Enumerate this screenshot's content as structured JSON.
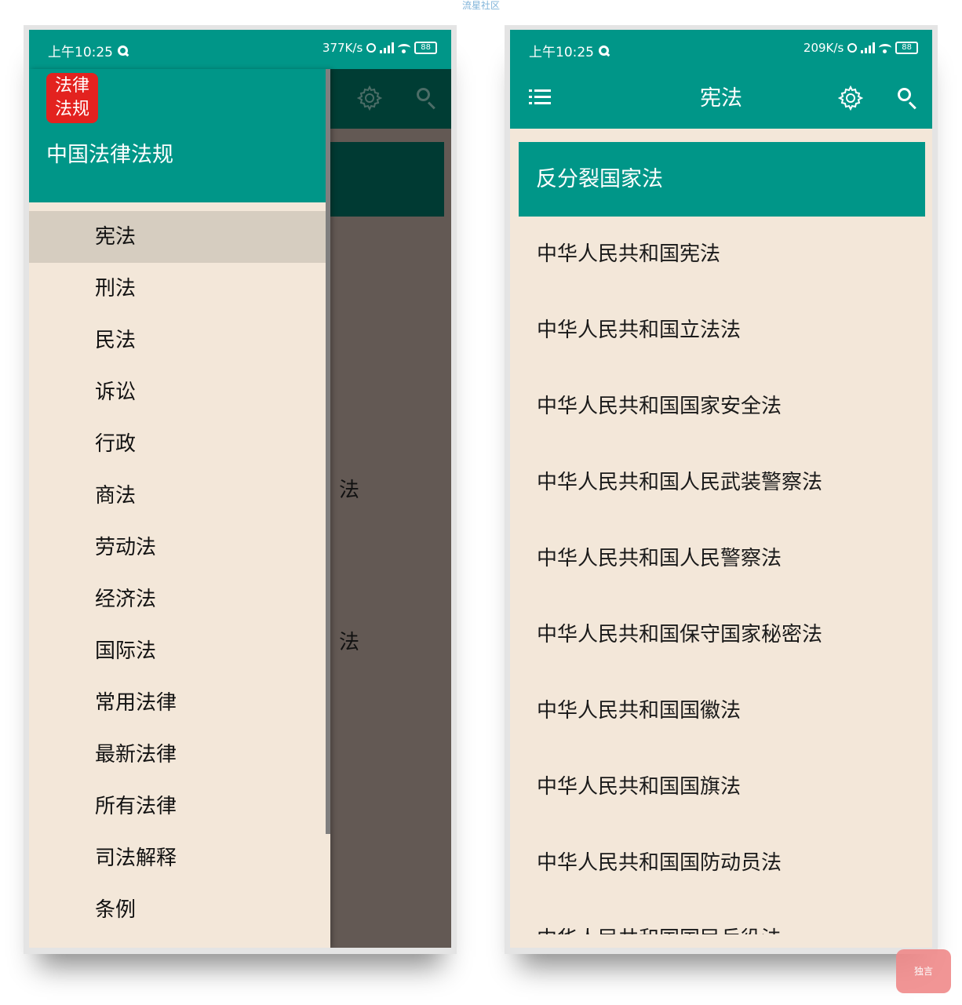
{
  "watermark": "流星社区",
  "left_phone": {
    "status": {
      "time": "上午10:25",
      "speed": "377K/s",
      "battery": "88"
    },
    "bg_fragments": [
      "法",
      "法"
    ],
    "drawer": {
      "logo_line1": "法律",
      "logo_line2": "法规",
      "title": "中国法律法规",
      "items": [
        "宪法",
        "刑法",
        "民法",
        "诉讼",
        "行政",
        "商法",
        "劳动法",
        "经济法",
        "国际法",
        "常用法律",
        "最新法律",
        "所有法律",
        "司法解释",
        "条例"
      ]
    }
  },
  "right_phone": {
    "status": {
      "time": "上午10:25",
      "speed": "209K/s",
      "battery": "88"
    },
    "appbar": {
      "title": "宪法"
    },
    "list": {
      "header": "反分裂国家法",
      "items": [
        "中华人民共和国宪法",
        "中华人民共和国立法法",
        "中华人民共和国国家安全法",
        "中华人民共和国人民武装警察法",
        "中华人民共和国人民警察法",
        "中华人民共和国保守国家秘密法",
        "中华人民共和国国徽法",
        "中华人民共和国国旗法",
        "中华人民共和国国防动员法",
        "中华人民共和国国民兵役法"
      ]
    }
  },
  "float_button": {
    "label": "独言"
  },
  "colors": {
    "primary": "#009688",
    "background": "#f3e7d9",
    "logo": "#e3221f"
  },
  "icons": [
    "menu-icon",
    "gear-icon",
    "search-icon"
  ]
}
